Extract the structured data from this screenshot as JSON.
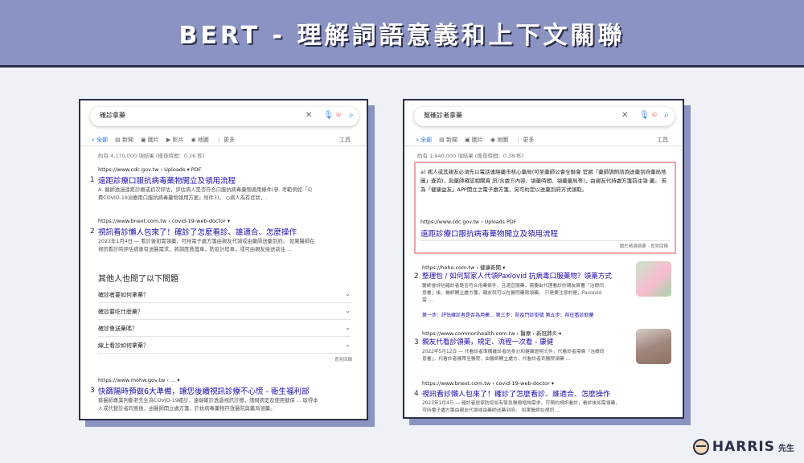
{
  "banner": {
    "title": "BERT - 理解詞語意義和上下文關聯"
  },
  "colors": {
    "banner_bg": "#8b93c3",
    "dark": "#2b2f4a",
    "link": "#1a0dab",
    "highlight_border": "#f1a3a8"
  },
  "tabs": [
    "全部",
    "新聞",
    "圖片",
    "影片",
    "地圖",
    "更多"
  ],
  "tools_label": "工具",
  "left": {
    "query": "確診拿藥",
    "stats": "約有 4,170,000 項結果 (搜尋時間：0.26 秒)",
    "results": [
      {
        "num": "1",
        "url": "https://www.cdc.gov.tw › Uploads ▾ PDF",
        "title": "遠距診療口服抗病毒藥物開立及領用流程",
        "snippet1": "A. 醫師透過遠距診療或初次評估，評估病人是否符合口服抗病毒藥物適用條件(參. 考範例如「公",
        "snippet2": "費COVID-19治療用口服抗病毒藥物領用方案」附件3)。 ○病人為有症狀，."
      },
      {
        "num": "2",
        "url": "https://www.bnext.com.tw › covid-19-web-doctor ▾",
        "title": "視訊看診懶人包來了！確診了怎麼看診、誰適合、怎麼操作",
        "snippet1": "2023年1月4日 — 看診後如需領藥，可持電子處方箋由親友代領或由藥師送藥到府。 如果醫師在",
        "snippet2": "視訊看診時評估病患有送醫需求，將調度救護車、防疫計程車，或可由親友接送前往 ..."
      }
    ],
    "paa_title": "其他人也問了以下問題",
    "paa": [
      "確診者要如何拿藥？",
      "確診要吃什麼藥？",
      "確診會送藥嗎？",
      "線上看診如何拿藥？"
    ],
    "feedback": "意見回饋",
    "result3": {
      "num": "3",
      "url": "https://www.mohw.gov.tw › ...  ▾",
      "title": "快篩陽時預做6大準備，讓您後續視訊診療不心慌 - 衛生福利部",
      "snippet1": "蔡醫師專業判斷老先生為COVID-19確診，遠端確診透過視訊診療，請問病史及使用健保 ... 取得本",
      "snippet2": "人或代替診者同意後，由醫師開立處方箋，於抗病毒藥物存放醫院與藥局領藥。"
    }
  },
  "right": {
    "query": "幫確診者拿藥",
    "stats": "約有 1,940,000 項結果 (搜尋時間：0.38 秒)",
    "featured_text": "a) 病人或其親友必須先以電話連絡藥市核心藥局(可至藥師公會全聯會 官網「藥師調劑諮詢送藥到府藥局地圖」查詢)，與藥師確認相關資 訊(含處方內容、領藥時間、領藥藥局等)，由親友代持處方箋前往領 藥。 若為「健康益友」APP開立之電子處方箋，另可約定以送藥到府方式領取。",
    "featured_url": "https://www.cdc.gov.tw › Uploads  PDF",
    "featured_title": "遠距診療口服抗病毒藥物開立及領用流程",
    "featured_meta": "關於精選摘要   ·   意見回饋",
    "results": [
      {
        "num": "2",
        "url": "https://heho.com.tw › 健康新聞  ▾",
        "title": "整理包 / 如何幫家人代領Paxlovid 抗病毒口服藥物？領藥方式",
        "snippet1": "醫師會評估確診者是否符合用藥條件，且適宜服藥，需要由代理看診的親友簽署「治療同",
        "snippet2": "意書」後，醫師開立處方箋，親友就可以在醫院藥局領藥。 只是要注意的是，Paxlovid",
        "snippet3": "需 ...",
        "sublinks": "第一步：評估確診者是否為用藥...   第三步：防疫門診掛號   第五步：前往看診取藥"
      },
      {
        "num": "3",
        "url": "https://www.commonhealth.com.tw › 醫療 › 新冠肺炎  ▾",
        "title": "親友代看診領藥，規定、流程一次看 - 康健",
        "snippet1": "2022年5月12日 — 代看診者準備確診者的身分和健康證明文件，代看診者需簽「治療同",
        "snippet2": "意書」，代看診者攜帶至醫院，由醫師開立處方，代看診者到醫院領藥 ..."
      },
      {
        "num": "4",
        "url": "https://www.bnext.com.tw › covid-19-web-doctor  ▾",
        "title": "視訊看診懶人包來了！確診了怎麼看診、誰適合、怎麼操作",
        "snippet1": "2023年1月4日 — 確診者居家防疫如有緊急醫療諮詢需求，可預約視訊看診，看診後如需領藥，",
        "snippet2": "可持電子處方箋由親友代領或由藥師送藥到府。 如果醫師在視訊 ..."
      }
    ]
  },
  "logo": {
    "name": "HARRIS",
    "suffix": "先生"
  }
}
